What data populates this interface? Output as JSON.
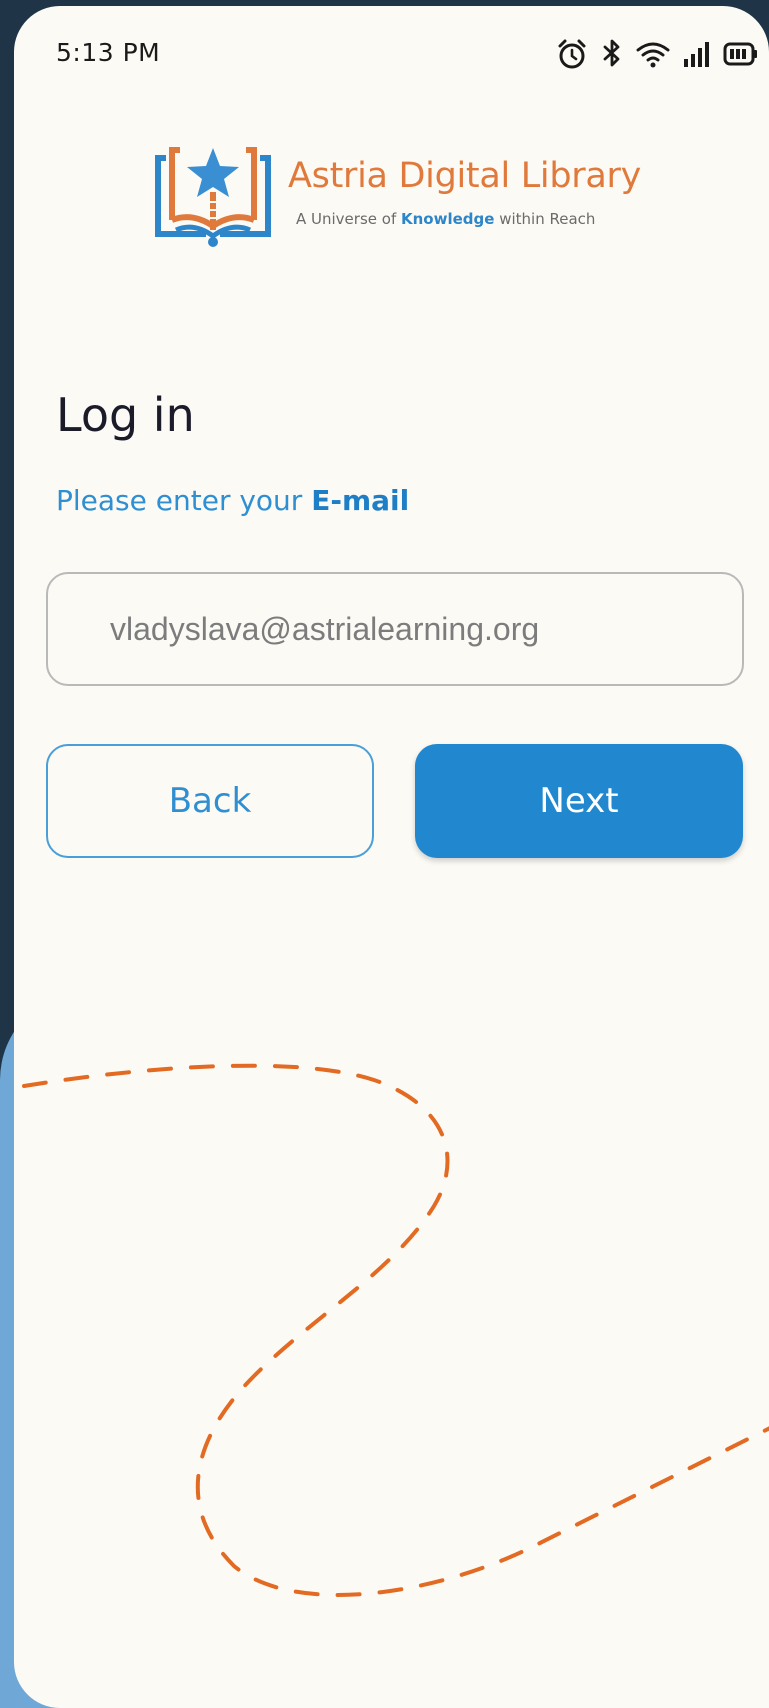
{
  "status_bar": {
    "time": "5:13 PM",
    "icons": [
      "alarm-icon",
      "bluetooth-icon",
      "wifi-icon",
      "signal-icon",
      "battery-icon"
    ]
  },
  "logo": {
    "title": "Astria Digital Library",
    "tagline_prefix": "A Universe of ",
    "tagline_keyword": "Knowledge",
    "tagline_suffix": " within Reach"
  },
  "login": {
    "title": "Log in",
    "subtitle_prefix": "Please enter your ",
    "subtitle_emphasis": "E-mail"
  },
  "email_field": {
    "value": "vladyslava@astrialearning.org"
  },
  "buttons": {
    "back_label": "Back",
    "next_label": "Next"
  },
  "colors": {
    "accent_blue": "#2188d0",
    "brand_orange": "#e07a3c",
    "background": "#fcfaf5",
    "frame": "#1f3447"
  }
}
